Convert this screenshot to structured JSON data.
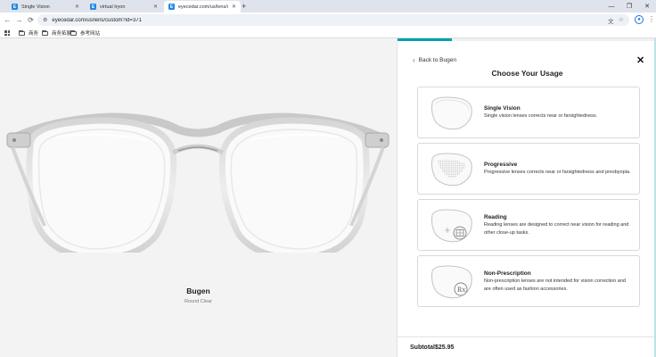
{
  "browser": {
    "tabs": [
      {
        "title": "Single Vision",
        "favicon": "E"
      },
      {
        "title": "virtual tryon",
        "favicon": "E"
      },
      {
        "title": "eyecedar.com/us/lens/custo",
        "favicon": "E"
      }
    ],
    "url": "eyecedar.com/us/lens/custom?id=371",
    "bookmarks": [
      "商务",
      "商务拓展",
      "参考网站"
    ]
  },
  "product": {
    "name": "Bugen",
    "color": "Round Clear"
  },
  "panel": {
    "back_label": "Back to Bugen",
    "title": "Choose Your Usage",
    "progress_fraction": 0.21,
    "accent_color": "#00a0b0",
    "options": [
      {
        "title": "Single Vision",
        "description": "Single vision lenses corrects near or farsightedness.",
        "icon": "single-vision-lens-icon"
      },
      {
        "title": "Progressive",
        "description": "Progressive lenses corrects near or farsightedness and presbyopia.",
        "icon": "progressive-lens-icon"
      },
      {
        "title": "Reading",
        "description": "Reading lenses are designed to correct near vision for reading and other close-up tasks.",
        "icon": "reading-lens-icon"
      },
      {
        "title": "Non-Prescription",
        "description": "Non-prescription lenses are not intended for vision correction and are often used as fashion accessories.",
        "icon": "non-prescription-lens-icon"
      }
    ],
    "subtotal_label": "Subtotal:",
    "subtotal_value": "$25.95"
  }
}
